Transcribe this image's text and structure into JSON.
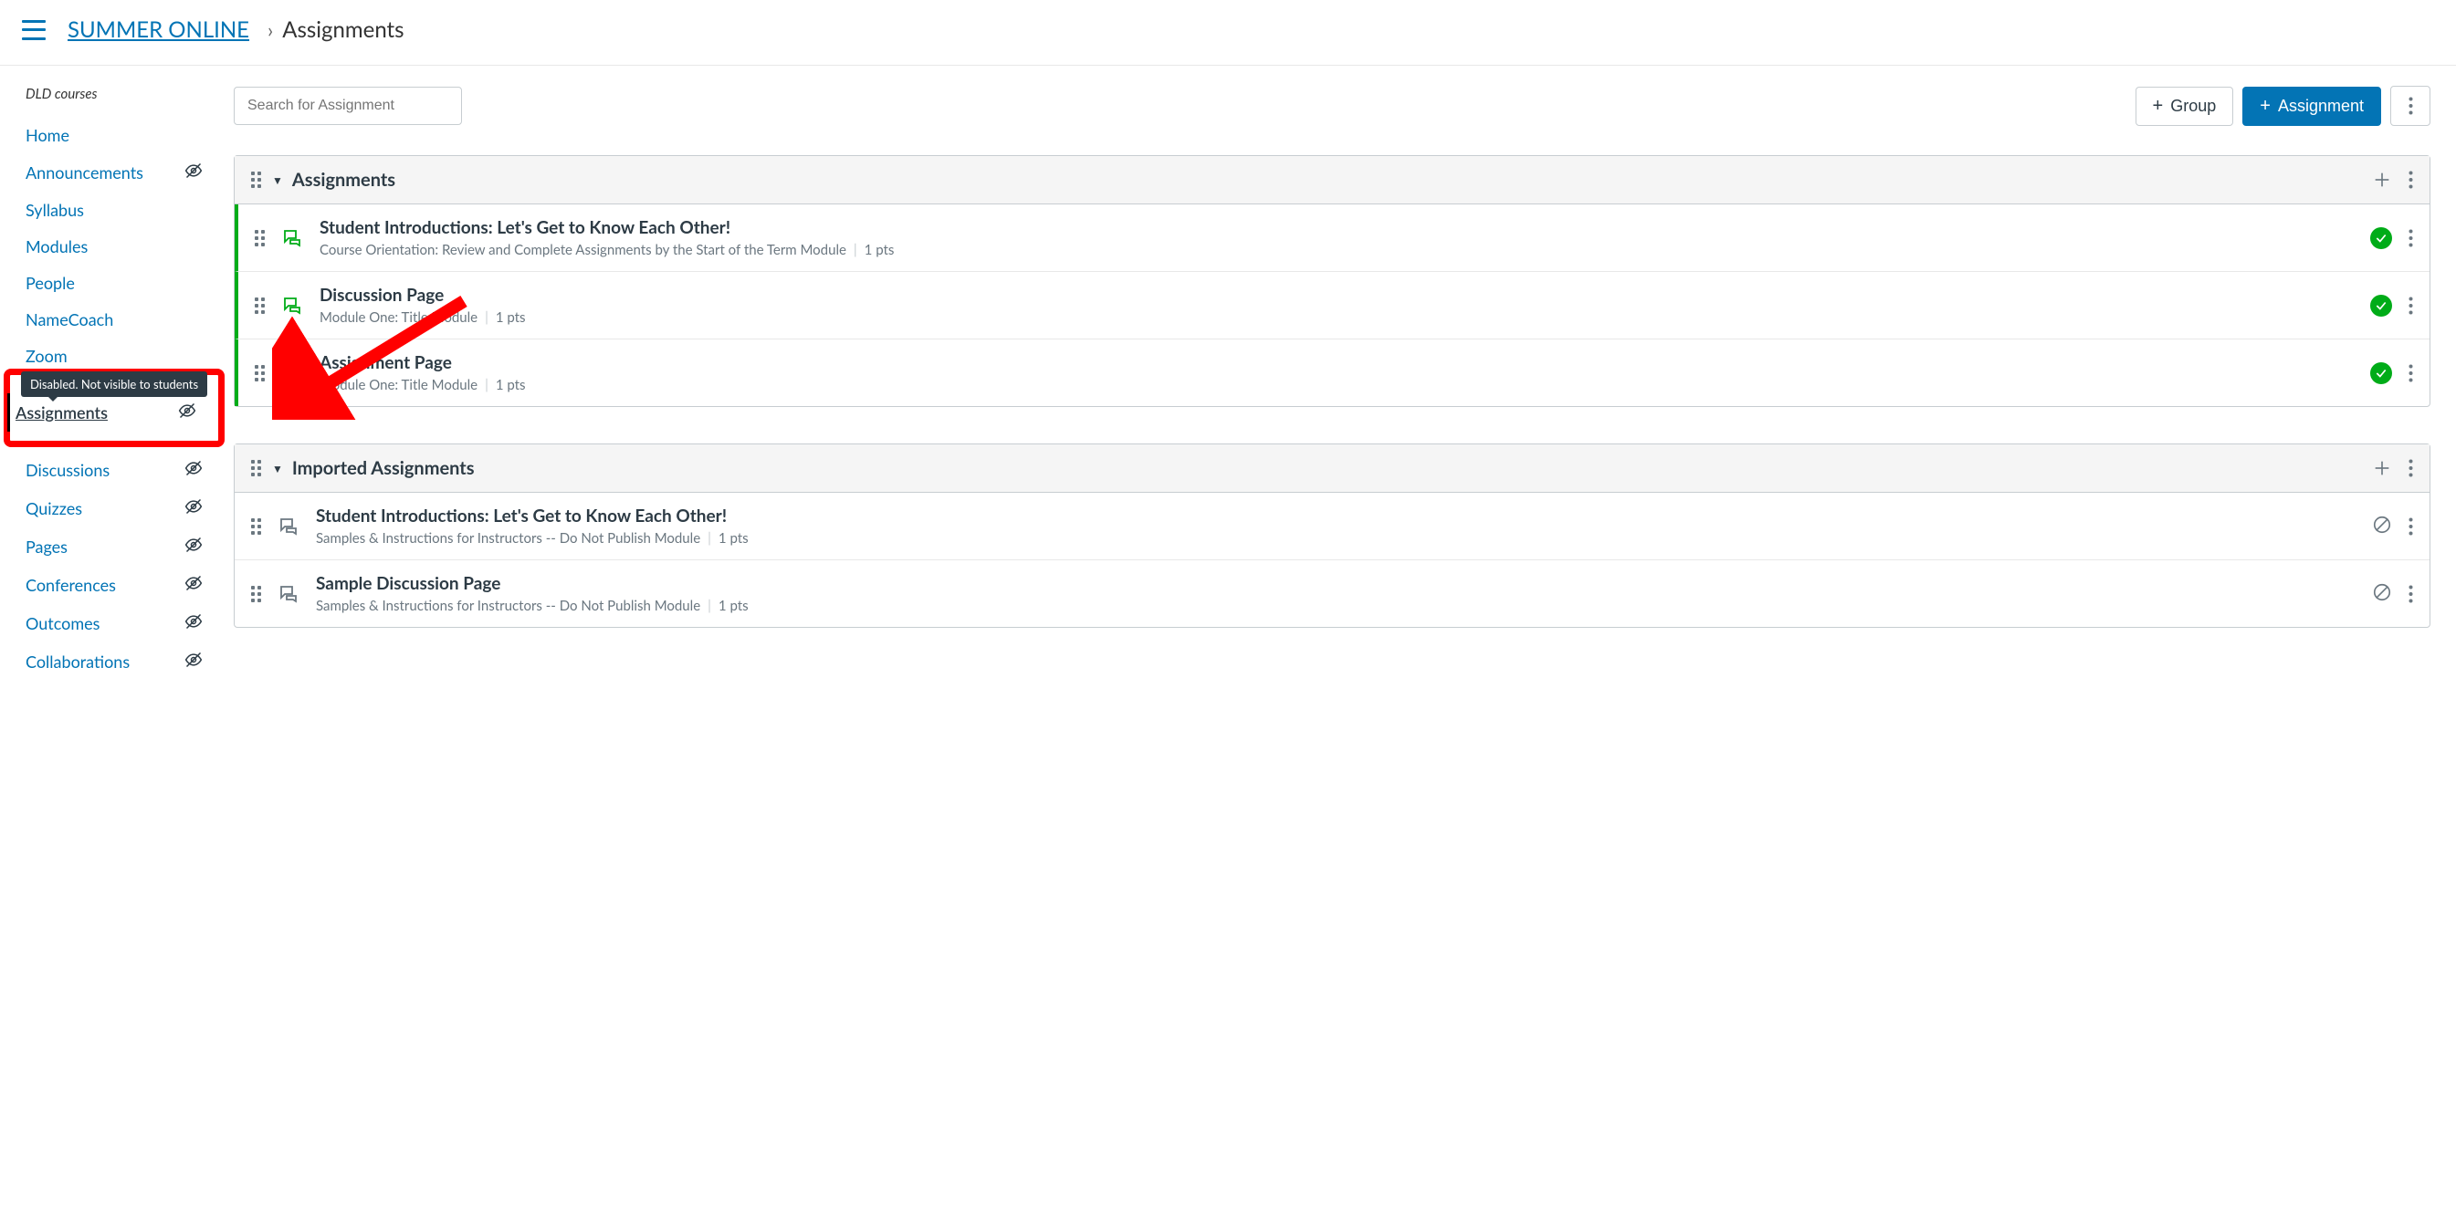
{
  "breadcrumb": {
    "course": "SUMMER ONLINE",
    "page": "Assignments"
  },
  "sidebar": {
    "section_title": "DLD courses",
    "items": [
      {
        "label": "Home",
        "disabled": false,
        "active": false
      },
      {
        "label": "Announcements",
        "disabled": true,
        "active": false
      },
      {
        "label": "Syllabus",
        "disabled": false,
        "active": false
      },
      {
        "label": "Modules",
        "disabled": false,
        "active": false
      },
      {
        "label": "People",
        "disabled": false,
        "active": false
      },
      {
        "label": "NameCoach",
        "disabled": false,
        "active": false
      },
      {
        "label": "Zoom",
        "disabled": false,
        "active": false
      },
      {
        "label": "Assignments",
        "disabled": true,
        "active": true
      },
      {
        "label": "Discussions",
        "disabled": true,
        "active": false
      },
      {
        "label": "Quizzes",
        "disabled": true,
        "active": false
      },
      {
        "label": "Pages",
        "disabled": true,
        "active": false
      },
      {
        "label": "Conferences",
        "disabled": true,
        "active": false
      },
      {
        "label": "Outcomes",
        "disabled": true,
        "active": false
      },
      {
        "label": "Collaborations",
        "disabled": true,
        "active": false
      }
    ],
    "tooltip": "Disabled. Not visible to students"
  },
  "toolbar": {
    "search_placeholder": "Search for Assignment",
    "group_label": "Group",
    "assignment_label": "Assignment"
  },
  "groups": [
    {
      "title": "Assignments",
      "published": true,
      "items": [
        {
          "title": "Student Introductions: Let's Get to Know Each Other!",
          "module": "Course Orientation: Review and Complete Assignments by the Start of the Term Module",
          "pts": "1 pts",
          "type": "discussion",
          "status": "published"
        },
        {
          "title": "Discussion Page",
          "module": "Module One: Title Module",
          "pts": "1 pts",
          "type": "discussion",
          "status": "published"
        },
        {
          "title": "Assignment Page",
          "module": "Module One: Title Module",
          "pts": "1 pts",
          "type": "assignment",
          "status": "published"
        }
      ]
    },
    {
      "title": "Imported Assignments",
      "published": false,
      "items": [
        {
          "title": "Student Introductions: Let's Get to Know Each Other!",
          "module": "Samples & Instructions for Instructors -- Do Not Publish Module",
          "pts": "1 pts",
          "type": "discussion",
          "status": "unpublished"
        },
        {
          "title": "Sample Discussion Page",
          "module": "Samples & Instructions for Instructors -- Do Not Publish Module",
          "pts": "1 pts",
          "type": "discussion",
          "status": "unpublished"
        }
      ]
    }
  ]
}
